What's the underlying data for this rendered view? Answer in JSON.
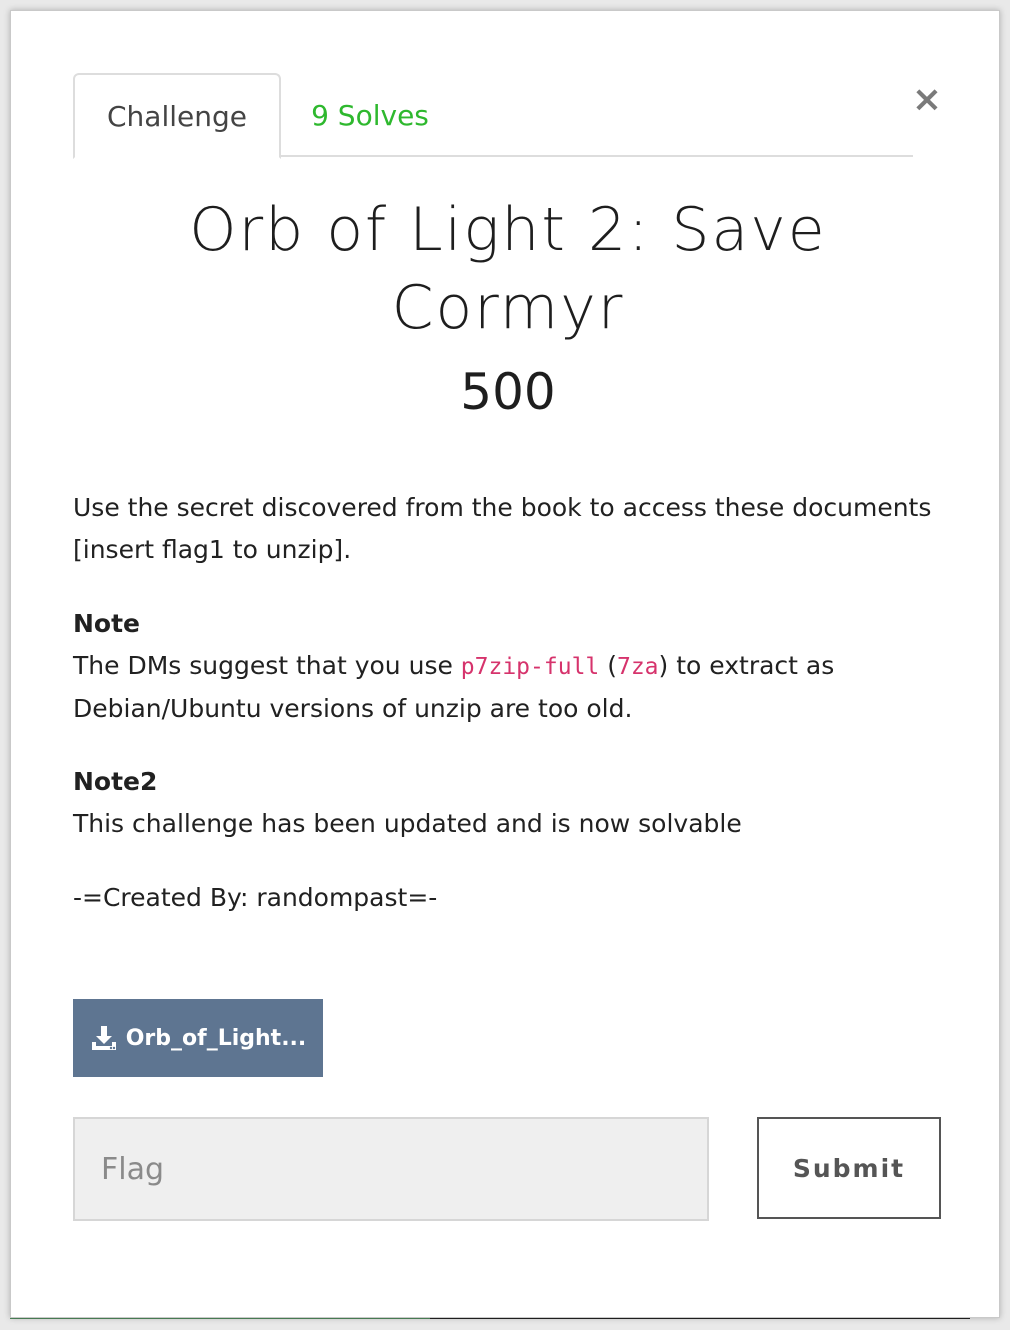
{
  "tabs": {
    "challenge": "Challenge",
    "solves": "9 Solves"
  },
  "close_symbol": "×",
  "challenge": {
    "title_line1": "Orb of Light 2: Save",
    "title_line2": "Cormyr",
    "value": "500",
    "description": {
      "intro_line1": "Use the secret discovered from the book to access these documents",
      "intro_line2": "[insert flag1 to unzip].",
      "note_heading": "Note",
      "note_text_before": "The DMs suggest that you use ",
      "note_code1": "p7zip-full",
      "note_text_mid1": " (",
      "note_code2": "7za",
      "note_text_mid2": ") to extract as",
      "note_text_line2": "Debian/Ubuntu versions of unzip are too old.",
      "note2_heading": "Note2",
      "note2_text": "This challenge has been updated and is now solvable",
      "created_by": "-=Created By: randompast=-"
    },
    "file_button_label": "Orb_of_Light..."
  },
  "flag_form": {
    "placeholder": "Flag",
    "submit_label": "Submit"
  },
  "colors": {
    "solves_green": "#2eb82e",
    "download_button": "#5e7591",
    "code_pink": "#d6336c"
  }
}
